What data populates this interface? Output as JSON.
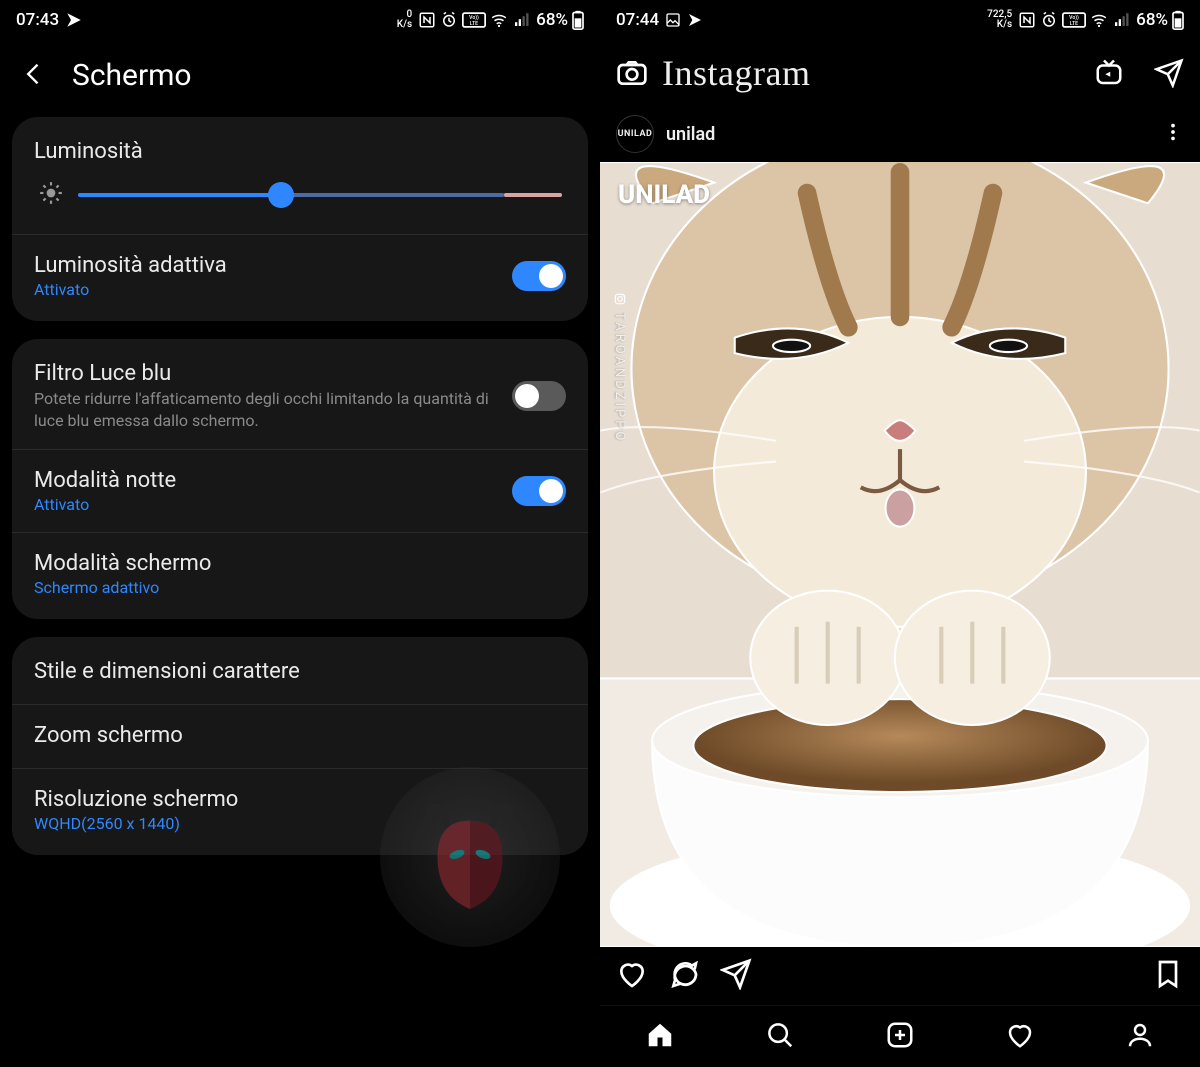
{
  "left": {
    "status": {
      "time": "07:43",
      "net": "0",
      "net_unit": "K/s",
      "battery": "68%"
    },
    "title": "Schermo",
    "brightness": {
      "label": "Luminosità",
      "value_pct": 42
    },
    "adaptive": {
      "title": "Luminosità adattiva",
      "status": "Attivato",
      "on": true
    },
    "bluelight": {
      "title": "Filtro Luce blu",
      "desc": "Potete ridurre l'affaticamento degli occhi limitando la quantità di luce blu emessa dallo schermo.",
      "on": false
    },
    "night": {
      "title": "Modalità notte",
      "status": "Attivato",
      "on": true
    },
    "screenmode": {
      "title": "Modalità schermo",
      "value": "Schermo adattivo"
    },
    "font": {
      "title": "Stile e dimensioni carattere"
    },
    "zoom": {
      "title": "Zoom schermo"
    },
    "resolution": {
      "title": "Risoluzione schermo",
      "value": "WQHD(2560 x 1440)"
    }
  },
  "right": {
    "status": {
      "time": "07:44",
      "net": "722,5",
      "net_unit": "K/s",
      "battery": "68%"
    },
    "app": "Instagram",
    "post": {
      "username": "unilad",
      "avatar_text": "UNILAD",
      "overlay_brand": "UNILAD",
      "overlay_credit": "TAROANDZIPPO"
    }
  }
}
